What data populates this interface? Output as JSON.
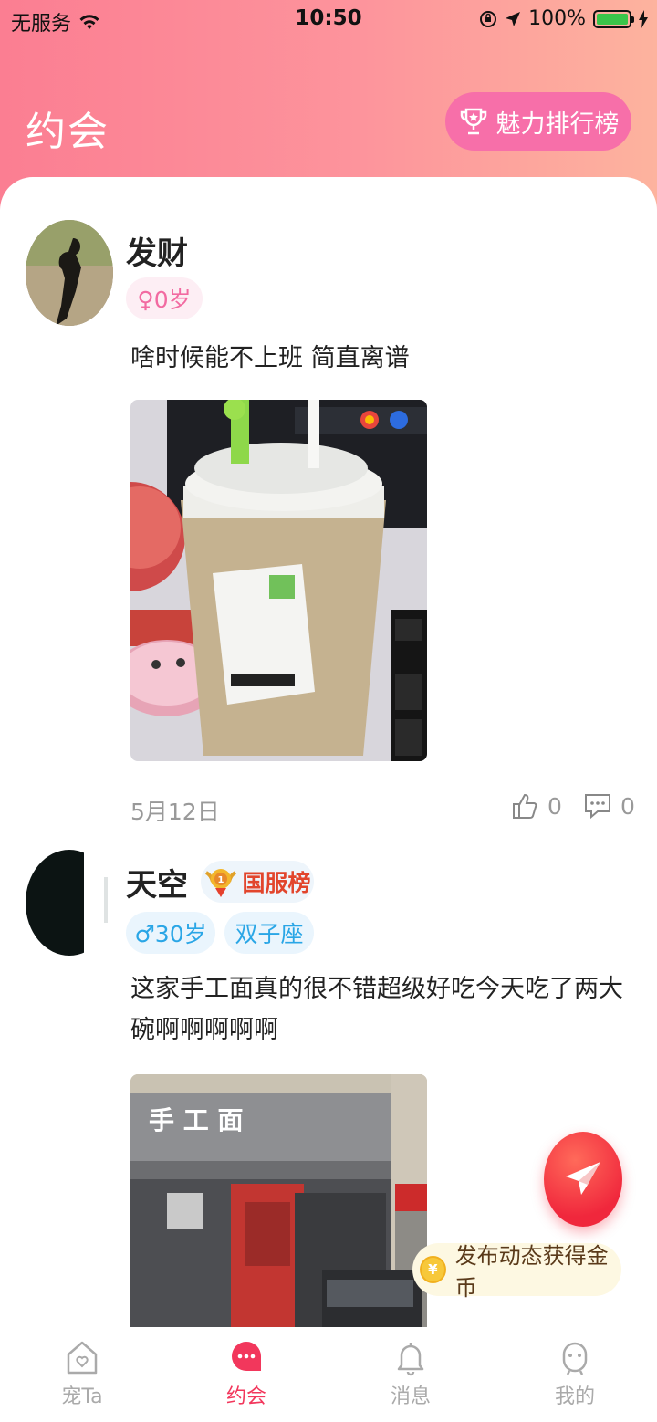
{
  "status_bar": {
    "carrier": "无服务",
    "time": "10:50",
    "battery": "100%"
  },
  "header": {
    "title": "约会",
    "rank_button": "魅力排行榜"
  },
  "posts": [
    {
      "username": "发财",
      "gender_age": "♀0岁",
      "text": "啥时候能不上班 简直离谱",
      "date": "5月12日",
      "likes": "0",
      "comments": "0"
    },
    {
      "username": "天空",
      "rank_badge": "国服榜",
      "gender_age": "♂30岁",
      "zodiac": "双子座",
      "text": "这家手工面真的很不错超级好吃今天吃了两大碗啊啊啊啊啊",
      "sign_text": "手 工 面"
    }
  ],
  "floating": {
    "coin_tip": "发布动态获得金币"
  },
  "tabbar": [
    {
      "label": "宠Ta",
      "icon": "house-heart-icon"
    },
    {
      "label": "约会",
      "icon": "chat-bubble-icon",
      "active": true
    },
    {
      "label": "消息",
      "icon": "bell-icon"
    },
    {
      "label": "我的",
      "icon": "person-icon"
    }
  ],
  "colors": {
    "header_start": "#fb7e92",
    "header_end": "#fdb39e",
    "rank_button": "#f76fa9",
    "accent": "#f2375c"
  }
}
